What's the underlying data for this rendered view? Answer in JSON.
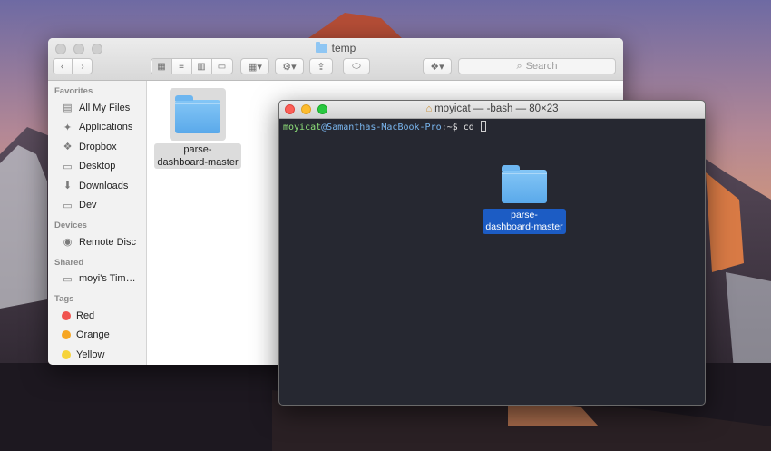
{
  "finder": {
    "title": "temp",
    "search_placeholder": "Search",
    "sidebar": {
      "favorites_header": "Favorites",
      "favorites": [
        {
          "label": "All My Files",
          "icon": "all-files-icon"
        },
        {
          "label": "Applications",
          "icon": "applications-icon"
        },
        {
          "label": "Dropbox",
          "icon": "dropbox-icon"
        },
        {
          "label": "Desktop",
          "icon": "desktop-icon"
        },
        {
          "label": "Downloads",
          "icon": "downloads-icon"
        },
        {
          "label": "Dev",
          "icon": "folder-icon"
        }
      ],
      "devices_header": "Devices",
      "devices": [
        {
          "label": "Remote Disc",
          "icon": "disc-icon"
        }
      ],
      "shared_header": "Shared",
      "shared": [
        {
          "label": "moyi's Tim…",
          "icon": "computer-icon"
        }
      ],
      "tags_header": "Tags",
      "tags": [
        {
          "label": "Red",
          "color": "#f0534f"
        },
        {
          "label": "Orange",
          "color": "#f6a623"
        },
        {
          "label": "Yellow",
          "color": "#f6d33a"
        }
      ]
    },
    "file": {
      "label_line1": "parse-",
      "label_line2": "dashboard-master"
    }
  },
  "terminal": {
    "title": "moyicat — -bash — 80×23",
    "prompt_user": "moyicat",
    "prompt_host": "@Samanthas-MacBook-Pro",
    "prompt_rest": ":~$ ",
    "command": "cd ",
    "file": {
      "label_line1": "parse-",
      "label_line2": "dashboard-master"
    }
  },
  "colors": {
    "selection": "#1c5cc4",
    "folder": "#5aa9ea",
    "terminal_bg": "#262831"
  }
}
